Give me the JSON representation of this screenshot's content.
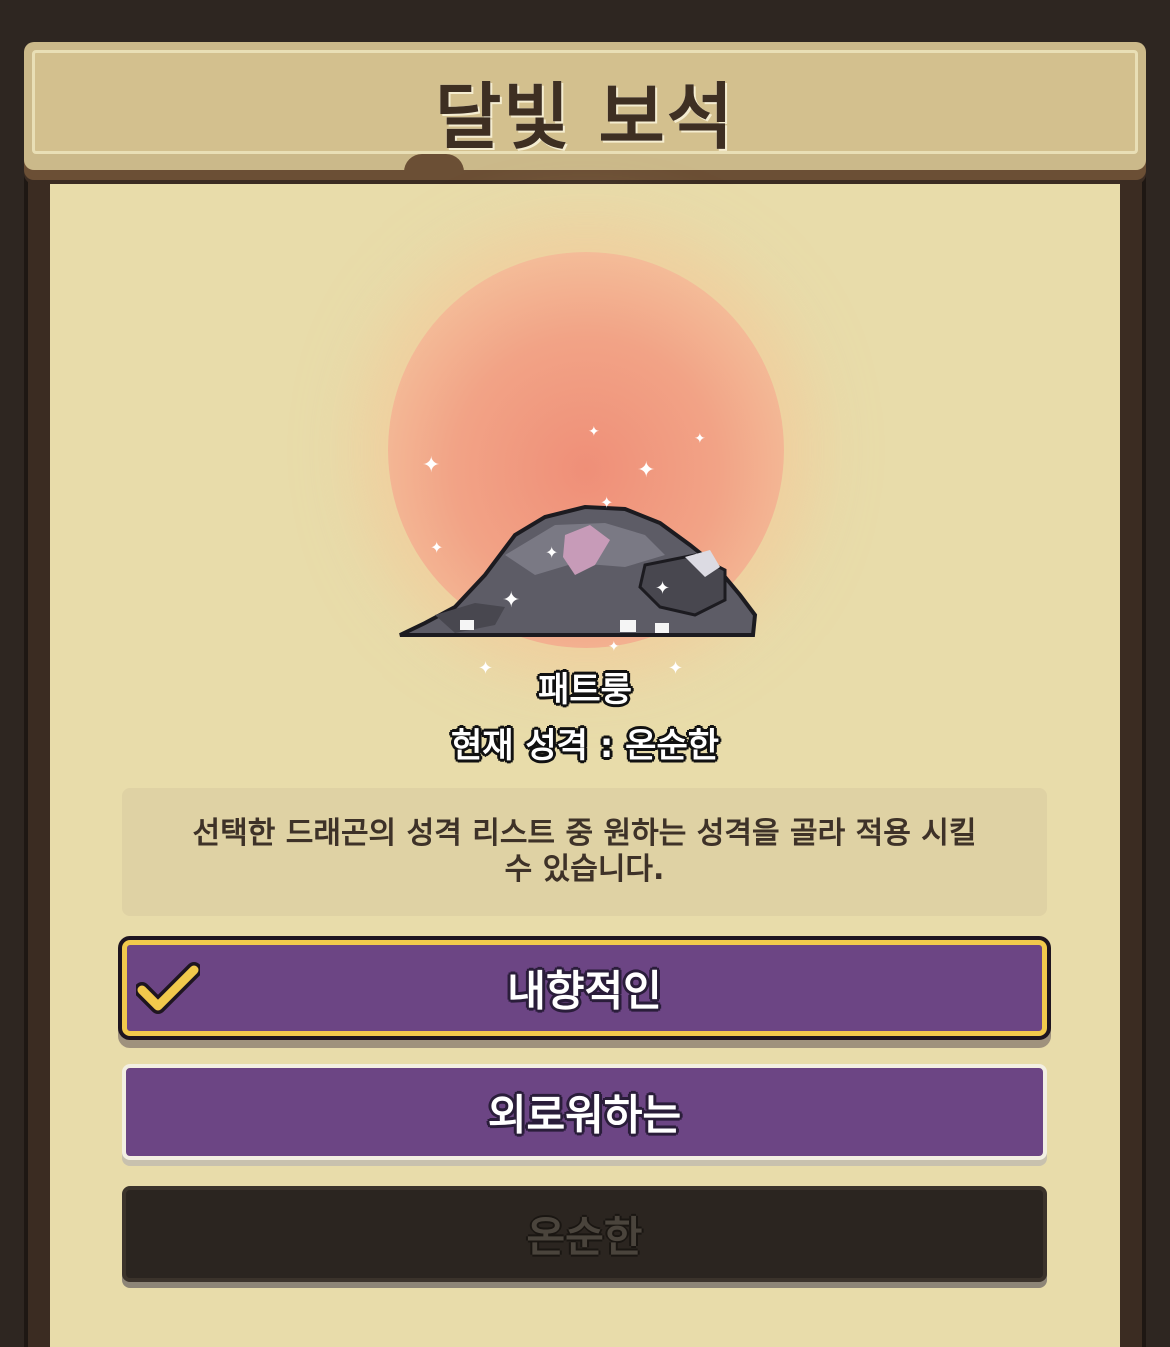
{
  "header": {
    "title": "달빛 보석"
  },
  "dragon": {
    "name": "패트룽",
    "current_personality": "현재 성격 : 온순한",
    "image_icon": "sleeping-gray-dragon-sprite"
  },
  "description": "선택한 드래곤의 성격 리스트 중 원하는 성격을 골라 적용 시킬 수 있습니다.",
  "options": [
    {
      "label": "내향적인",
      "selected": true,
      "disabled": false
    },
    {
      "label": "외로워하는",
      "selected": false,
      "disabled": false
    },
    {
      "label": "온순한",
      "selected": false,
      "disabled": true
    }
  ],
  "colors": {
    "option_purple": "#6c4584",
    "selected_border": "#f2c94c",
    "disabled_bg": "#2b2520",
    "panel_bg": "#e8dcaa"
  }
}
